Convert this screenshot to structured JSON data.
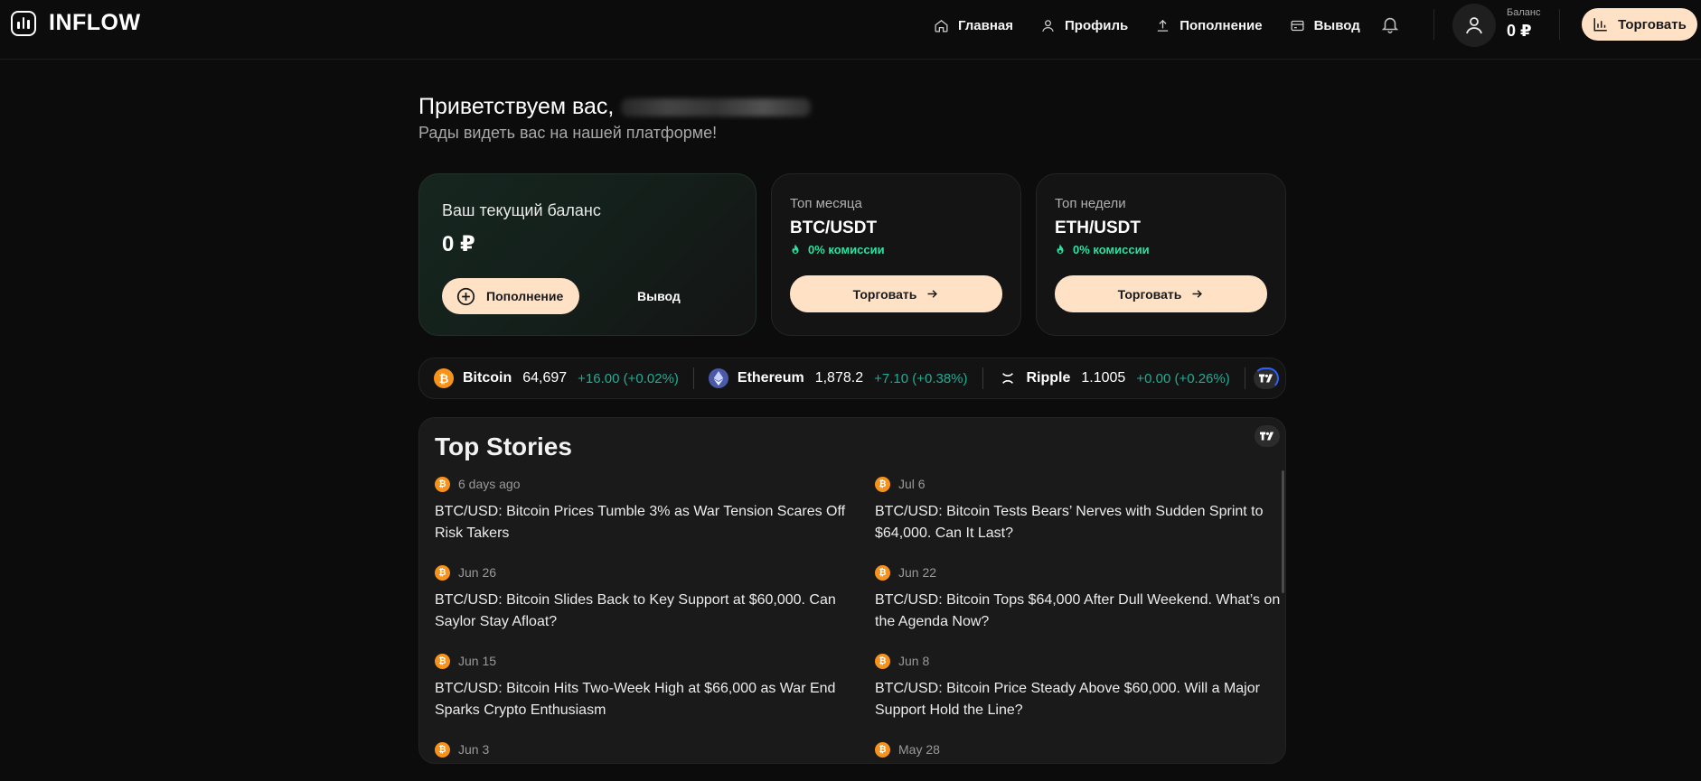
{
  "header": {
    "logo_text": "INFLOW",
    "nav": [
      {
        "label": "Главная",
        "icon": "home-icon"
      },
      {
        "label": "Профиль",
        "icon": "user-icon"
      },
      {
        "label": "Пополнение",
        "icon": "upload-icon"
      },
      {
        "label": "Вывод",
        "icon": "wallet-icon"
      }
    ],
    "balance_label": "Баланс",
    "balance_value": "0 ₽",
    "trade_label": "Торговать"
  },
  "greeting": {
    "title": "Приветствуем вас,",
    "subtitle": "Рады видеть вас на нашей платформе!"
  },
  "balance_card": {
    "title": "Ваш текущий баланс",
    "value": "0 ₽",
    "deposit_label": "Пополнение",
    "withdraw_label": "Вывод"
  },
  "top_cards": [
    {
      "label": "Топ месяца",
      "pair": "BTC/USDT",
      "fee": "0% комиссии",
      "button": "Торговать"
    },
    {
      "label": "Топ недели",
      "pair": "ETH/USDT",
      "fee": "0% комиссии",
      "button": "Торговать"
    }
  ],
  "ticker": [
    {
      "name": "Bitcoin",
      "price": "64,697",
      "change": "+16.00 (+0.02%)",
      "icon": "bitcoin-icon",
      "color": "#f7931a"
    },
    {
      "name": "Ethereum",
      "price": "1,878.2",
      "change": "+7.10 (+0.38%)",
      "icon": "ethereum-icon",
      "color": "#627eea"
    },
    {
      "name": "Ripple",
      "price": "1.1005",
      "change": "+0.00 (+0.26%)",
      "icon": "ripple-icon",
      "color": "#ffffff"
    }
  ],
  "stories": {
    "title": "Top Stories",
    "items": [
      {
        "date": "6 days ago",
        "headline": "BTC/USD: Bitcoin Prices Tumble 3% as War Tension Scares Off Risk Takers"
      },
      {
        "date": "Jul 6",
        "headline": "BTC/USD: Bitcoin Tests Bears’ Nerves with Sudden Sprint to $64,000. Can It Last?"
      },
      {
        "date": "Jun 26",
        "headline": "BTC/USD: Bitcoin Slides Back to Key Support at $60,000. Can Saylor Stay Afloat?"
      },
      {
        "date": "Jun 22",
        "headline": "BTC/USD: Bitcoin Tops $64,000 After Dull Weekend. What’s on the Agenda Now?"
      },
      {
        "date": "Jun 15",
        "headline": "BTC/USD: Bitcoin Hits Two-Week High at $66,000 as War End Sparks Crypto Enthusiasm"
      },
      {
        "date": "Jun 8",
        "headline": "BTC/USD: Bitcoin Price Steady Above $60,000. Will a Major Support Hold the Line?"
      },
      {
        "date": "Jun 3",
        "headline": ""
      },
      {
        "date": "May 28",
        "headline": ""
      }
    ]
  },
  "colors": {
    "accent": "#ffe2c6",
    "positive": "#22ab94",
    "fee_green": "#2fe0a2"
  }
}
